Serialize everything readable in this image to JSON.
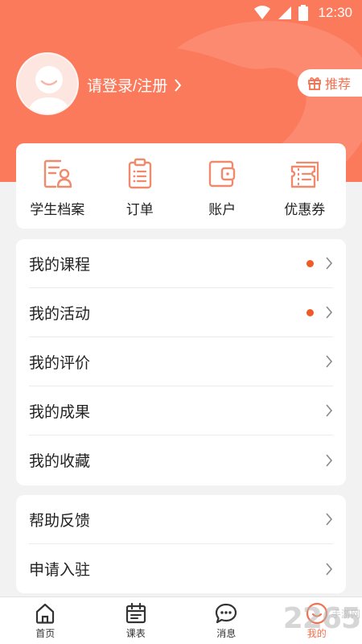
{
  "status_bar": {
    "time": "12:30"
  },
  "profile": {
    "login_text": "请登录/注册"
  },
  "recommend": {
    "label": "推荐"
  },
  "quick_actions": [
    {
      "label": "学生档案",
      "icon": "student-profile-icon"
    },
    {
      "label": "订单",
      "icon": "order-clipboard-icon"
    },
    {
      "label": "账户",
      "icon": "wallet-icon"
    },
    {
      "label": "优惠券",
      "icon": "coupon-icon"
    }
  ],
  "menu": [
    {
      "label": "我的课程",
      "badge": true
    },
    {
      "label": "我的活动",
      "badge": true
    },
    {
      "label": "我的评价",
      "badge": false
    },
    {
      "label": "我的成果",
      "badge": false
    },
    {
      "label": "我的收藏",
      "badge": false
    }
  ],
  "menu2": [
    {
      "label": "帮助反馈"
    },
    {
      "label": "申请入驻"
    }
  ],
  "tabs": [
    {
      "label": "首页",
      "icon": "home-icon"
    },
    {
      "label": "课表",
      "icon": "calendar-icon"
    },
    {
      "label": "消息",
      "icon": "message-icon"
    },
    {
      "label": "我的",
      "icon": "profile-icon",
      "active": true
    }
  ],
  "colors": {
    "accent": "#fc7a5c",
    "badge": "#f05a28",
    "icon_stroke": "#f08a6c"
  },
  "watermark": {
    "brand": "2265",
    "sub": "手游网"
  }
}
